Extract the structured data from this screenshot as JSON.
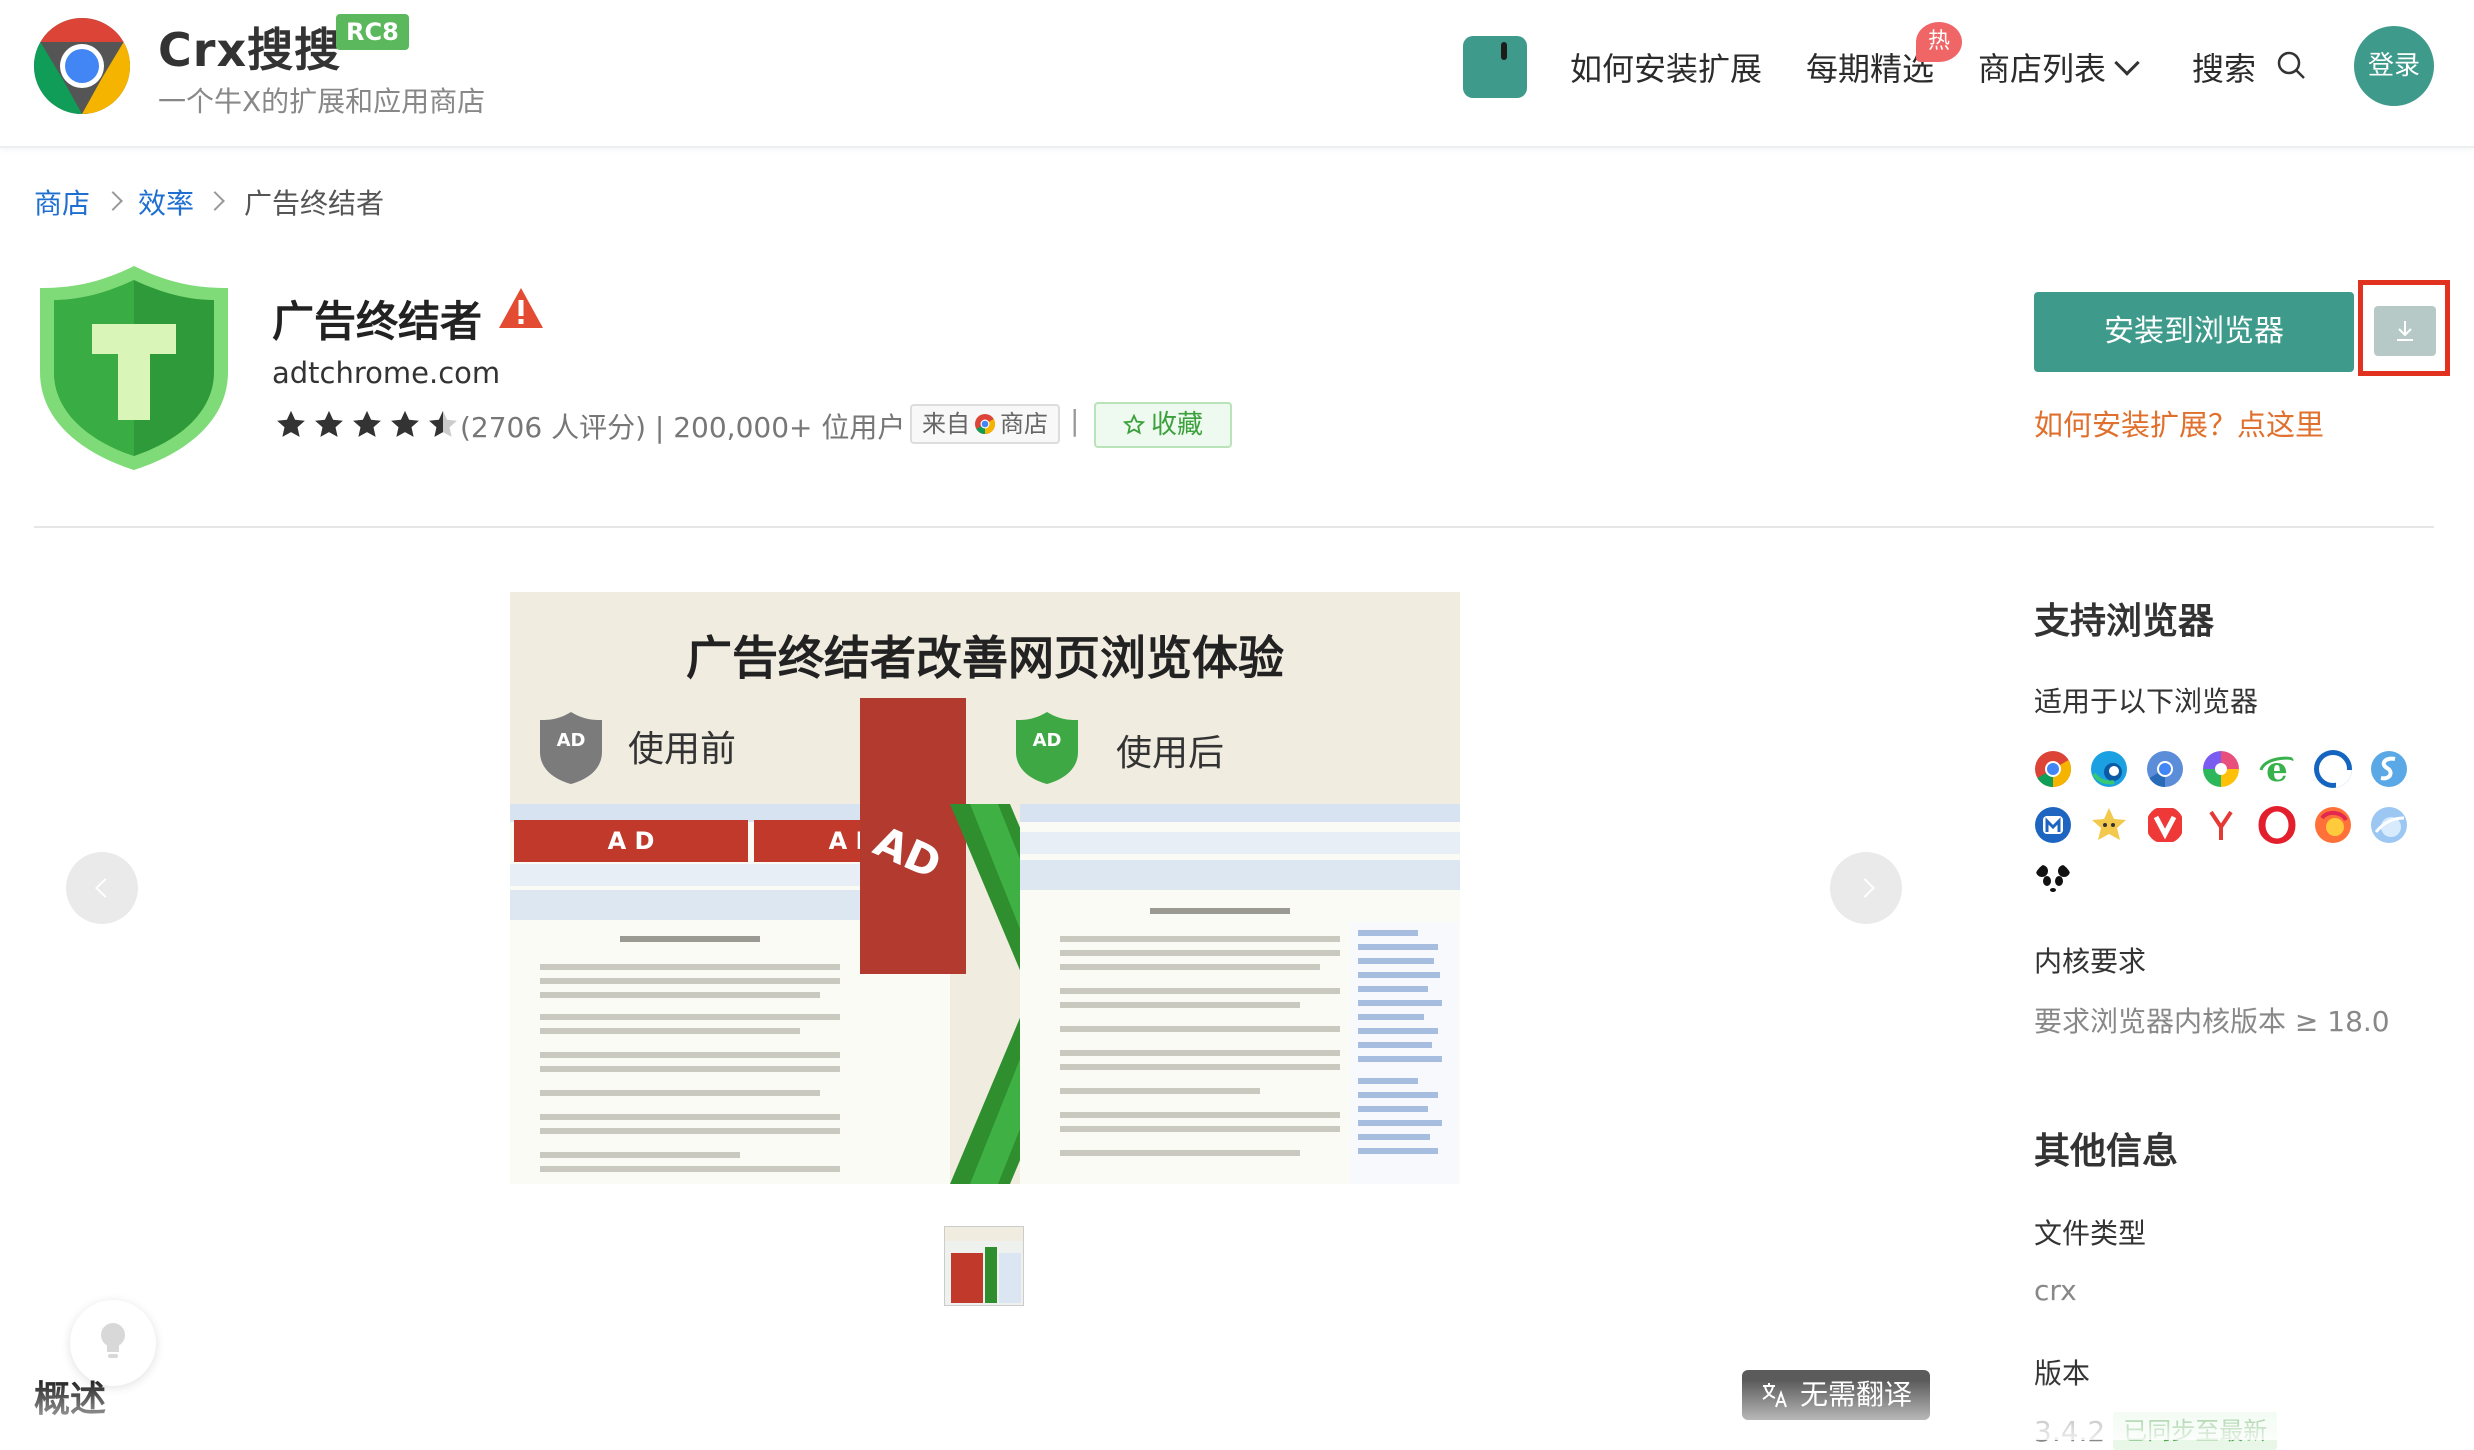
{
  "header": {
    "brand": "Crx搜搜",
    "version_badge": "RC8",
    "slogan": "一个牛X的扩展和应用商店",
    "nav": {
      "how_to_install": "如何安装扩展",
      "weekly_picks": "每期精选",
      "hot_badge": "热",
      "store_list": "商店列表",
      "search": "搜索",
      "login": "登录"
    }
  },
  "breadcrumb": [
    "商店",
    "效率",
    "广告终结者"
  ],
  "extension": {
    "name": "广告终结者",
    "domain": "adtchrome.com",
    "rating_value": 4.5,
    "rating_text": "(2706 人评分) | 200,000+ 位用户 |",
    "source_prefix": "来自",
    "source_suffix": "商店",
    "favorite": "收藏",
    "install_button": "安装到浏览器",
    "howto_link": "如何安装扩展？点这里"
  },
  "gallery": {
    "title": "广告终结者改善网页浏览体验",
    "before": "使用前",
    "after": "使用后",
    "ad_label": "A D",
    "ad_side": "AD"
  },
  "overview_title": "概述",
  "translate_button": "无需翻译",
  "sidebar": {
    "browsers_title": "支持浏览器",
    "browsers_subtitle": "适用于以下浏览器",
    "browser_icons": [
      "chrome-icon",
      "edge-icon",
      "chromium-icon",
      "360-icon",
      "ie-icon",
      "opera-gx-icon",
      "sogou-icon",
      "maxthon-icon",
      "star-browser-icon",
      "vivaldi-icon",
      "yandex-icon",
      "opera-icon",
      "firefox-icon",
      "qq-browser-icon",
      "panda-icon"
    ],
    "kernel_title": "内核要求",
    "kernel_value": "要求浏览器内核版本 ≥ 18.0",
    "other_title": "其他信息",
    "file_type_label": "文件类型",
    "file_type_value": "crx",
    "version_label": "版本",
    "version_value": "3.4.2",
    "sync_badge": "已同步至最新"
  },
  "colors": {
    "primary": "#3e9a8b",
    "link": "#1f6fd1",
    "accent_orange": "#e0702d",
    "highlight_red": "#e0321f",
    "badge_green": "#5cb85c"
  }
}
